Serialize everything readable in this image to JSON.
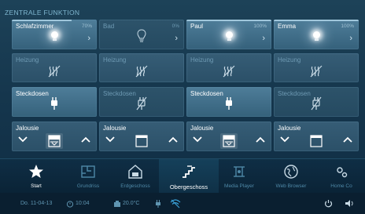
{
  "section": {
    "title": "ZENTRALE FUNKTION"
  },
  "tiles": {
    "row0": [
      {
        "label": "Schlafzimmer",
        "percent": "70%",
        "state": "on",
        "level": 0.7
      },
      {
        "label": "Bad",
        "percent": "0%",
        "state": "off",
        "level": 0.0
      },
      {
        "label": "Paul",
        "percent": "100%",
        "state": "on",
        "level": 1.0
      },
      {
        "label": "Emma",
        "percent": "100%",
        "state": "on",
        "level": 1.0
      }
    ],
    "row1": [
      {
        "label": "Heizung"
      },
      {
        "label": "Heizung"
      },
      {
        "label": "Heizung"
      },
      {
        "label": "Heizung"
      }
    ],
    "row2": [
      {
        "label": "Steckdosen",
        "state": "on"
      },
      {
        "label": "Steckdosen",
        "state": "off"
      },
      {
        "label": "Steckdosen",
        "state": "on"
      },
      {
        "label": "Steckdosen",
        "state": "off"
      }
    ],
    "row3": [
      {
        "label": "Jalousie",
        "state": "down"
      },
      {
        "label": "Jalousie",
        "state": "open"
      },
      {
        "label": "Jalousie",
        "state": "down"
      },
      {
        "label": "Jalousie",
        "state": "open"
      }
    ]
  },
  "nav": {
    "start": "Start",
    "grundriss": "Grundriss",
    "erdgeschoss": "Erdgeschoss",
    "obergeschoss": "Obergeschoss",
    "media_player": "Media Player",
    "web_browser": "Web Browser",
    "home_control": "Home Co"
  },
  "status": {
    "date": "Do. 11-04-13",
    "time": "10:04",
    "temperature": "20.0°C"
  },
  "colors": {
    "accent": "#9fc6db",
    "background": "#15364d",
    "active_text": "#ffffff",
    "inactive_text": "#4f89a8"
  }
}
